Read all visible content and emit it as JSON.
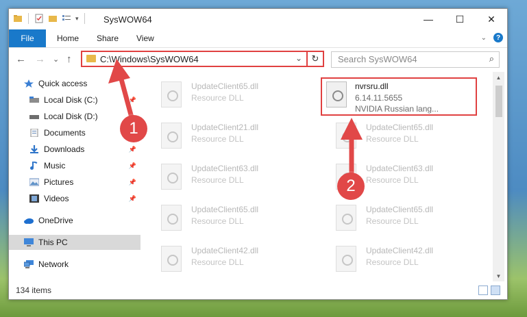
{
  "window": {
    "title": "SysWOW64",
    "controls": {
      "minimize": "—",
      "maximize": "☐",
      "close": "✕"
    }
  },
  "ribbon": {
    "file": "File",
    "tabs": [
      "Home",
      "Share",
      "View"
    ]
  },
  "nav": {
    "back": "←",
    "forward": "→",
    "recent": "⌄",
    "up": "↑",
    "address": "C:\\Windows\\SysWOW64",
    "dropdown": "⌄",
    "refresh": "↻",
    "search_placeholder": "Search SysWOW64",
    "search_icon": "⌕"
  },
  "sidebar": {
    "items": [
      {
        "label": "Quick access",
        "icon": "star-icon",
        "pinned": false
      },
      {
        "label": "Local Disk (C:)",
        "icon": "disk-icon",
        "pinned": true
      },
      {
        "label": "Local Disk (D:)",
        "icon": "disk-icon",
        "pinned": false
      },
      {
        "label": "Documents",
        "icon": "document-icon",
        "pinned": true
      },
      {
        "label": "Downloads",
        "icon": "download-icon",
        "pinned": true
      },
      {
        "label": "Music",
        "icon": "music-icon",
        "pinned": true
      },
      {
        "label": "Pictures",
        "icon": "pictures-icon",
        "pinned": true
      },
      {
        "label": "Videos",
        "icon": "videos-icon",
        "pinned": true
      },
      {
        "label": "OneDrive",
        "icon": "cloud-icon",
        "pinned": false
      },
      {
        "label": "This PC",
        "icon": "computer-icon",
        "pinned": false
      },
      {
        "label": "Network",
        "icon": "network-icon",
        "pinned": false
      }
    ]
  },
  "files": {
    "highlighted": {
      "name": "nvrsru.dll",
      "version": "6.14.11.5655",
      "description": "NVIDIA Russian lang..."
    },
    "left_column": [
      {
        "name": "UpdateClient65.dll",
        "type": "Resource DLL"
      },
      {
        "name": "UpdateClient21.dll",
        "type": "Resource DLL"
      },
      {
        "name": "UpdateClient63.dll",
        "type": "Resource DLL"
      },
      {
        "name": "UpdateClient65.dll",
        "type": "Resource DLL"
      },
      {
        "name": "UpdateClient42.dll",
        "type": "Resource DLL"
      }
    ],
    "right_column": [
      {
        "name": "UpdateClient65.dll",
        "type": "Resource DLL"
      },
      {
        "name": "UpdateClient63.dll",
        "type": "Resource DLL"
      },
      {
        "name": "UpdateClient65.dll",
        "type": "Resource DLL"
      },
      {
        "name": "UpdateClient42.dll",
        "type": "Resource DLL"
      }
    ]
  },
  "status": {
    "item_count": "134 items"
  },
  "annotations": {
    "step1": "1",
    "step2": "2"
  },
  "colors": {
    "accent": "#1979ca",
    "highlight_red": "#e04040",
    "marker_red": "#e14848",
    "folder_yellow": "#e8b84a"
  }
}
